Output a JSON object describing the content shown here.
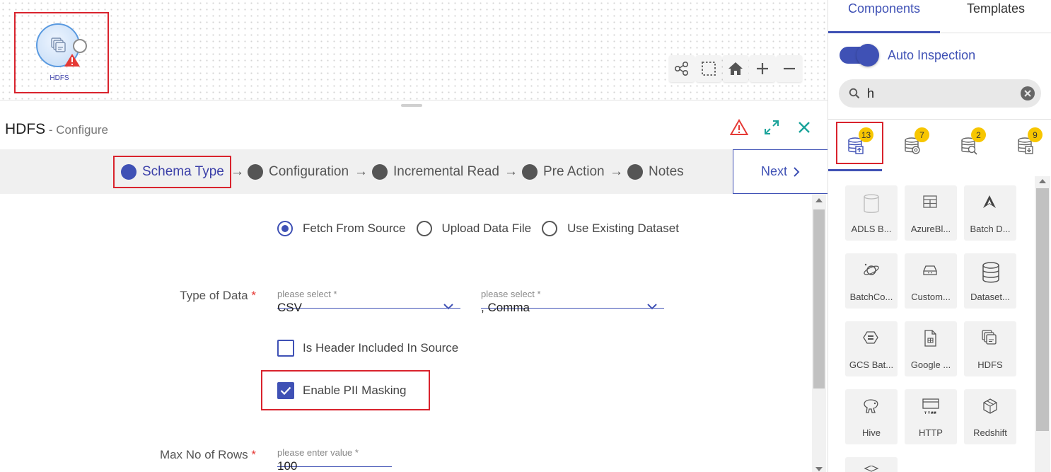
{
  "canvas": {
    "node_label": "HDFS"
  },
  "configure": {
    "title": "HDFS",
    "subtitle": " - Configure"
  },
  "stepper": {
    "steps": [
      "Schema Type",
      "Configuration",
      "Incremental Read",
      "Pre Action",
      "Notes"
    ],
    "active_index": 0,
    "arrow": "→",
    "next_label": "Next"
  },
  "form": {
    "radios": [
      {
        "label": "Fetch From Source",
        "selected": true
      },
      {
        "label": "Upload Data File",
        "selected": false
      },
      {
        "label": "Use Existing Dataset",
        "selected": false
      }
    ],
    "type_of_data": {
      "label": "Type of Data",
      "required_mark": "*",
      "format_placeholder": "please select *",
      "format_value": "CSV",
      "delimiter_placeholder": "please select *",
      "delimiter_value": ", Comma"
    },
    "header_checkbox": {
      "label": "Is Header Included In Source",
      "checked": false
    },
    "pii_checkbox": {
      "label": "Enable PII Masking",
      "checked": true
    },
    "max_rows": {
      "label": "Max No of Rows",
      "required_mark": "*",
      "placeholder": "please enter value *",
      "value": "100"
    }
  },
  "right_panel": {
    "tabs": [
      "Components",
      "Templates"
    ],
    "active_tab": "Components",
    "auto_inspection": {
      "label": "Auto Inspection",
      "on": true
    },
    "search": {
      "value": "h"
    },
    "categories": [
      {
        "icon": "source-db-icon",
        "count": "13",
        "active": true
      },
      {
        "icon": "processor-db-icon",
        "count": "7",
        "active": false
      },
      {
        "icon": "analytics-db-icon",
        "count": "2",
        "active": false
      },
      {
        "icon": "emitter-db-icon",
        "count": "9",
        "active": false
      }
    ],
    "components": [
      {
        "label": "ADLS B...",
        "icon": "adls-icon"
      },
      {
        "label": "AzureBl...",
        "icon": "azure-blob-icon"
      },
      {
        "label": "Batch D...",
        "icon": "batch-d-icon"
      },
      {
        "label": "BatchCo...",
        "icon": "batch-cosmos-icon"
      },
      {
        "label": "Custom...",
        "icon": "custom-icon"
      },
      {
        "label": "Dataset...",
        "icon": "dataset-icon"
      },
      {
        "label": "GCS Bat...",
        "icon": "gcs-icon"
      },
      {
        "label": "Google ...",
        "icon": "google-sheet-icon"
      },
      {
        "label": "HDFS",
        "icon": "hdfs-icon"
      },
      {
        "label": "Hive",
        "icon": "hive-icon"
      },
      {
        "label": "HTTP",
        "icon": "http-icon"
      },
      {
        "label": "Redshift",
        "icon": "redshift-icon"
      }
    ]
  },
  "colors": {
    "accent": "#3f51b5",
    "highlight": "#d9232d",
    "badge": "#f7c600",
    "warning": "#e53935"
  }
}
